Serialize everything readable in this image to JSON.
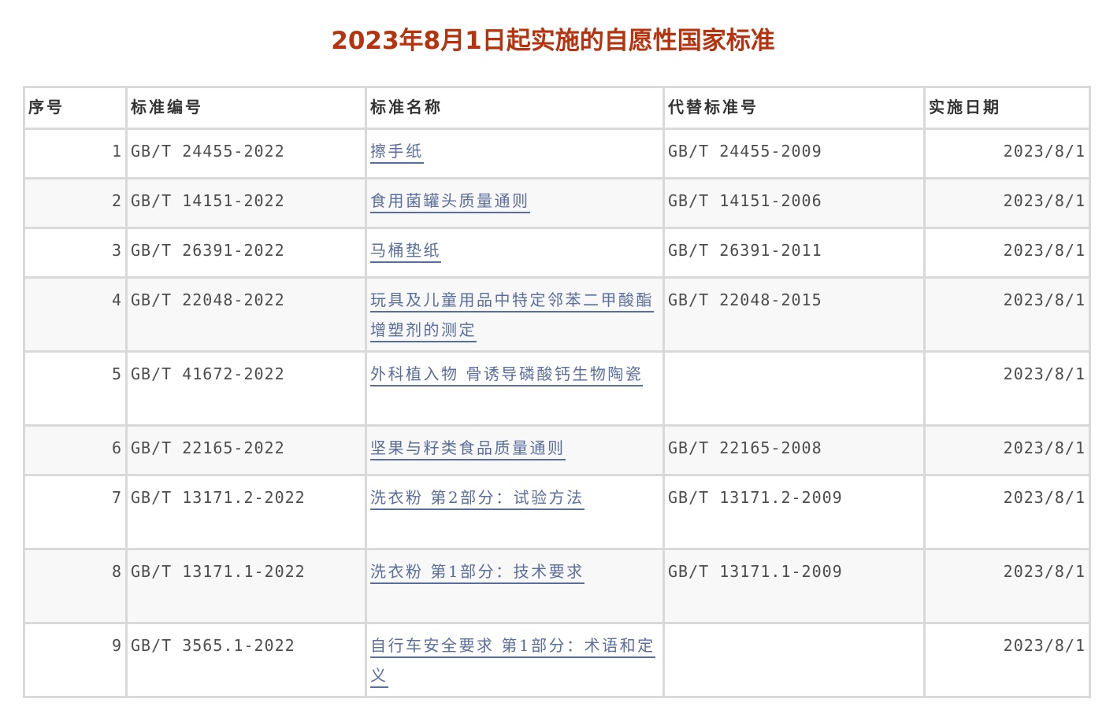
{
  "title": "2023年8月1日起实施的自愿性国家标准",
  "table": {
    "headers": [
      "序号",
      "标准编号",
      "标准名称",
      "代替标准号",
      "实施日期"
    ],
    "rows": [
      {
        "index": "1",
        "code": "GB/T 24455-2022",
        "name": "擦手纸",
        "replaces": "GB/T 24455-2009",
        "date": "2023/8/1"
      },
      {
        "index": "2",
        "code": "GB/T 14151-2022",
        "name": "食用菌罐头质量通则",
        "replaces": "GB/T 14151-2006",
        "date": "2023/8/1"
      },
      {
        "index": "3",
        "code": "GB/T 26391-2022",
        "name": "马桶垫纸",
        "replaces": "GB/T 26391-2011",
        "date": "2023/8/1"
      },
      {
        "index": "4",
        "code": "GB/T 22048-2022",
        "name": "玩具及儿童用品中特定邻苯二甲酸酯增塑剂的测定",
        "replaces": "GB/T 22048-2015",
        "date": "2023/8/1"
      },
      {
        "index": "5",
        "code": "GB/T 41672-2022",
        "name": "外科植入物 骨诱导磷酸钙生物陶瓷",
        "replaces": "",
        "date": "2023/8/1"
      },
      {
        "index": "6",
        "code": "GB/T 22165-2022",
        "name": "坚果与籽类食品质量通则",
        "replaces": "GB/T 22165-2008",
        "date": "2023/8/1"
      },
      {
        "index": "7",
        "code": "GB/T 13171.2-2022",
        "name": "洗衣粉 第2部分：试验方法",
        "replaces": "GB/T 13171.2-2009",
        "date": "2023/8/1"
      },
      {
        "index": "8",
        "code": "GB/T 13171.1-2022",
        "name": "洗衣粉 第1部分：技术要求",
        "replaces": "GB/T 13171.1-2009",
        "date": "2023/8/1"
      },
      {
        "index": "9",
        "code": "GB/T 3565.1-2022",
        "name": "自行车安全要求 第1部分：术语和定义",
        "replaces": "",
        "date": "2023/8/1"
      }
    ]
  },
  "colors": {
    "title": "#b5340f",
    "link": "#5a6e9c",
    "border": "#d9d9d9",
    "alt_row": "#f8f8f8"
  }
}
